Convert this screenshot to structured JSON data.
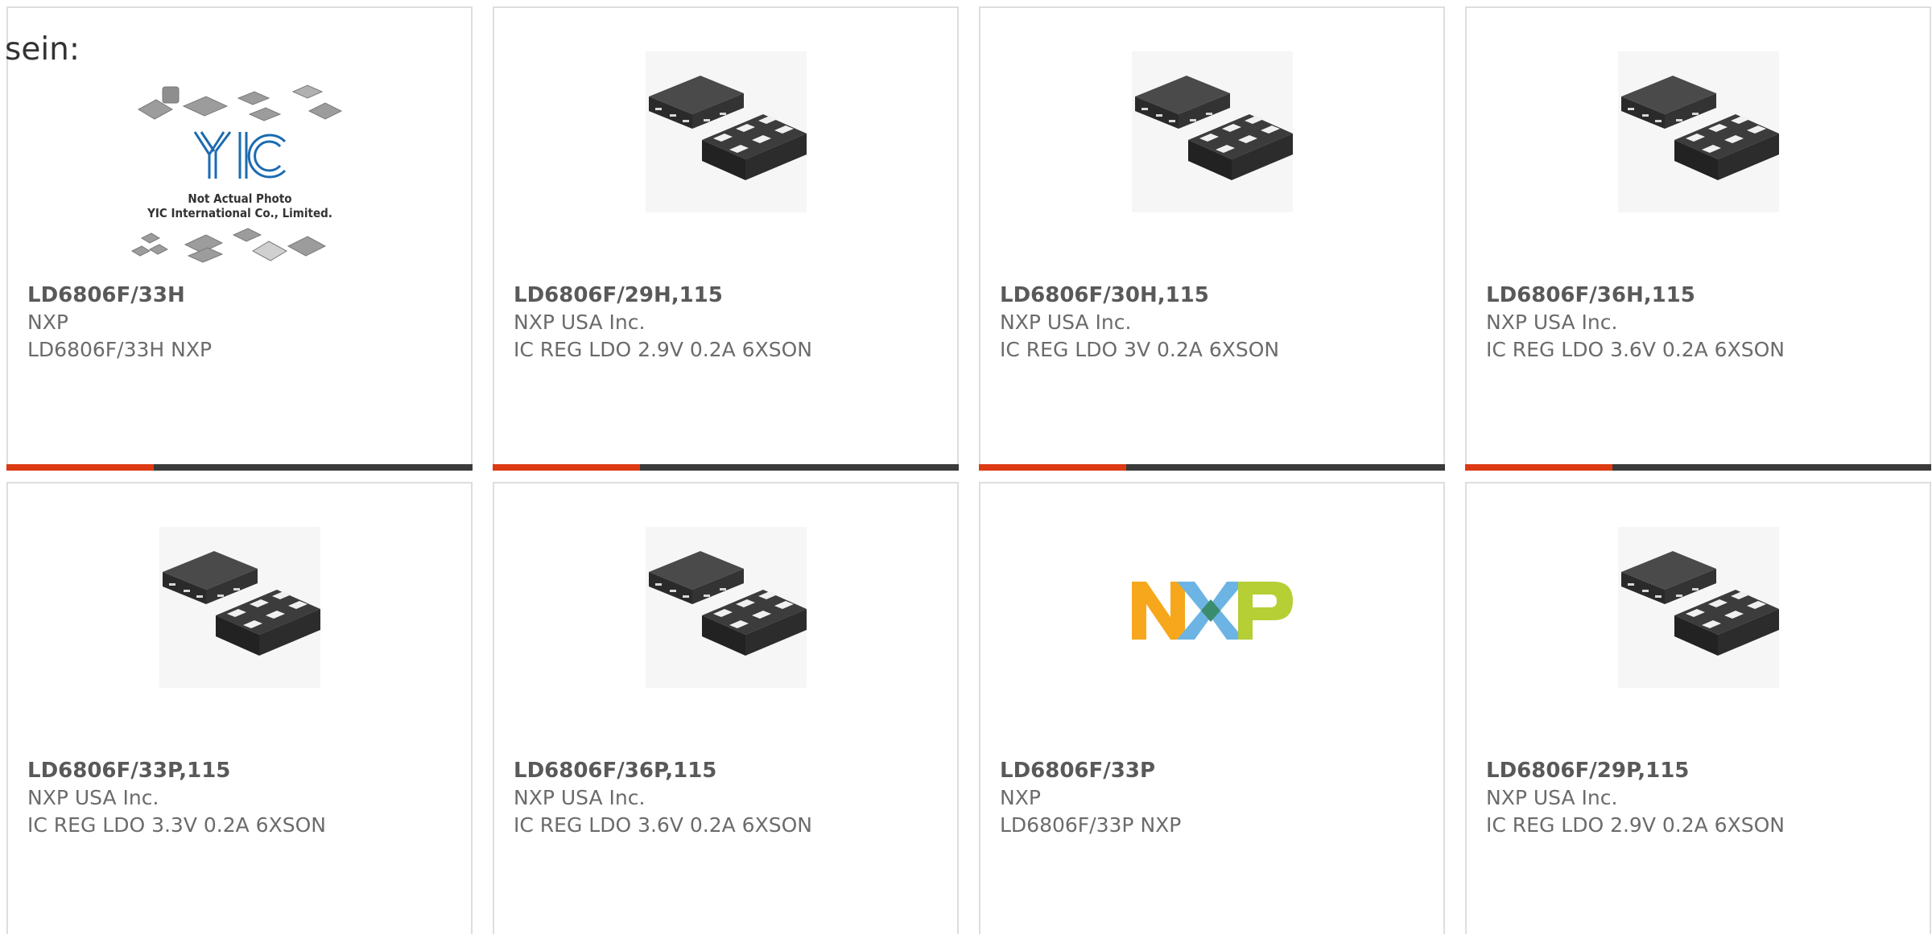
{
  "lead_text": "sein:",
  "colors": {
    "card_border": "#dedede",
    "bar_dark": "#3a3a3a",
    "bar_accent": "#dc3a12",
    "part_text": "#595959",
    "body_text": "#6b6b6b",
    "yic_blue": "#1b6bb0",
    "nxp_orange": "#f7a71c",
    "nxp_blue": "#6cb4e4",
    "nxp_green": "#b5cf35"
  },
  "products": [
    {
      "part": "LD6806F/33H",
      "manufacturer": "NXP",
      "description": "LD6806F/33H NXP",
      "image": "not-actual-photo-placeholder",
      "image_brand": "YIC",
      "image_caption_line1": "Not Actual Photo",
      "image_caption_line2": "YIC International Co., Limited."
    },
    {
      "part": "LD6806F/29H,115",
      "manufacturer": "NXP USA Inc.",
      "description": "IC REG LDO 2.9V 0.2A 6XSON",
      "image": "xson6-package-photo"
    },
    {
      "part": "LD6806F/30H,115",
      "manufacturer": "NXP USA Inc.",
      "description": "IC REG LDO 3V 0.2A 6XSON",
      "image": "xson6-package-photo"
    },
    {
      "part": "LD6806F/36H,115",
      "manufacturer": "NXP USA Inc.",
      "description": "IC REG LDO 3.6V 0.2A 6XSON",
      "image": "xson6-package-photo"
    },
    {
      "part": "LD6806F/33P,115",
      "manufacturer": "NXP USA Inc.",
      "description": "IC REG LDO 3.3V 0.2A 6XSON",
      "image": "xson6-package-photo"
    },
    {
      "part": "LD6806F/36P,115",
      "manufacturer": "NXP USA Inc.",
      "description": "IC REG LDO 3.6V 0.2A 6XSON",
      "image": "xson6-package-photo"
    },
    {
      "part": "LD6806F/33P",
      "manufacturer": "NXP",
      "description": "LD6806F/33P NXP",
      "image": "nxp-logo"
    },
    {
      "part": "LD6806F/29P,115",
      "manufacturer": "NXP USA Inc.",
      "description": "IC REG LDO 2.9V 0.2A 6XSON",
      "image": "xson6-package-photo"
    }
  ]
}
